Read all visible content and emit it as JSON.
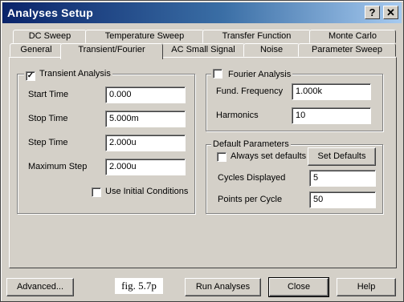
{
  "window": {
    "title": "Analyses Setup",
    "help_glyph": "?",
    "close_glyph": "✕"
  },
  "tabs_row1": [
    "DC Sweep",
    "Temperature Sweep",
    "Transfer Function",
    "Monte Carlo"
  ],
  "tabs_row2": [
    "General",
    "Transient/Fourier",
    "AC Small Signal",
    "Noise",
    "Parameter Sweep"
  ],
  "active_tab": "Transient/Fourier",
  "transient": {
    "title": "Transient Analysis",
    "enabled": true,
    "check_glyph": "✓",
    "fields": [
      {
        "label": "Start Time",
        "value": "0.000"
      },
      {
        "label": "Stop Time",
        "value": "5.000m"
      },
      {
        "label": "Step Time",
        "value": "2.000u"
      },
      {
        "label": "Maximum Step",
        "value": "2.000u"
      }
    ],
    "use_initial_conditions": {
      "label": "Use Initial Conditions",
      "checked": false
    }
  },
  "fourier": {
    "title": "Fourier Analysis",
    "enabled": false,
    "fields": [
      {
        "label": "Fund. Frequency",
        "value": "1.000k"
      },
      {
        "label": "Harmonics",
        "value": "10"
      }
    ]
  },
  "defaults": {
    "title": "Default Parameters",
    "always_set": {
      "label": "Always set defaults",
      "checked": false
    },
    "set_defaults_button": "Set Defaults",
    "fields": [
      {
        "label": "Cycles Displayed",
        "value": "5"
      },
      {
        "label": "Points per Cycle",
        "value": "50"
      }
    ]
  },
  "footer": {
    "advanced_button": "Advanced...",
    "annotation": "fig. 5.7p",
    "run_button": "Run Analyses",
    "close_button": "Close",
    "help_button": "Help"
  }
}
